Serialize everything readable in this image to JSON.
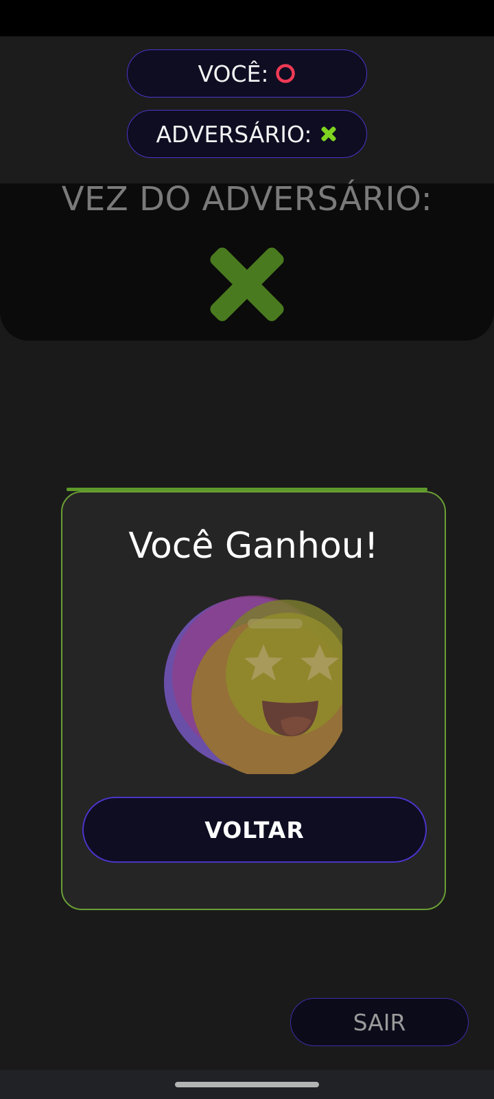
{
  "players": {
    "you": {
      "label": "VOCÊ:",
      "symbol_icon": "circle-o-icon",
      "color": "#ef3a55"
    },
    "opponent": {
      "label": "ADVERSÁRIO:",
      "symbol_icon": "x-mark-icon",
      "color": "#7ed321"
    }
  },
  "turn": {
    "text": "VEZ DO ADVERSÁRIO:",
    "symbol_icon": "x-mark-icon",
    "color": "#4a7a1f"
  },
  "modal": {
    "title": "Você Ganhou!",
    "emoji_icon": "star-eyes-emoji-icon",
    "back_label": "VOLTAR",
    "accent_color": "#6a9f35"
  },
  "exit": {
    "label": "SAIR"
  },
  "colors": {
    "background": "#1a1a1a",
    "button_fill": "#0e0d22",
    "button_border": "#4a35c9"
  }
}
